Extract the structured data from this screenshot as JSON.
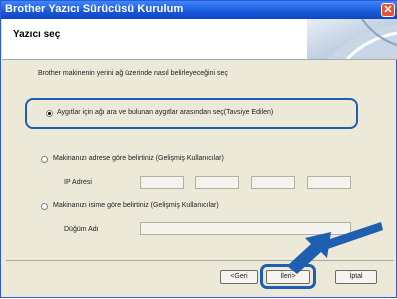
{
  "window": {
    "title": "Brother Yazıcı Sürücüsü Kurulum",
    "close_glyph": "✕"
  },
  "header": {
    "title": "Yazıcı seç"
  },
  "intro": "Brother makinenin yerini ağ üzerinde nasıl belirleyeceğini seç",
  "options": [
    {
      "label": "Aygıtlar için ağı ara ve bulunan aygıtlar arasından seç(Tavsiye Edilen)",
      "selected": true
    },
    {
      "label": "Makinanızı adrese göre belirtiniz (Gelişmiş Kullanıcılar)",
      "selected": false
    },
    {
      "label": "Makinanızı isime göre belirtiniz (Gelişmiş Kullanıcılar)",
      "selected": false
    }
  ],
  "ip": {
    "label": "IP Adresi",
    "octets": [
      "",
      "",
      "",
      ""
    ]
  },
  "node": {
    "label": "Düğüm Adı",
    "value": ""
  },
  "buttons": {
    "back": "<Geri",
    "next": "İleri>",
    "cancel": "İptal"
  },
  "colors": {
    "titlebar": "#1957d6",
    "highlight": "#1f5fb2"
  }
}
